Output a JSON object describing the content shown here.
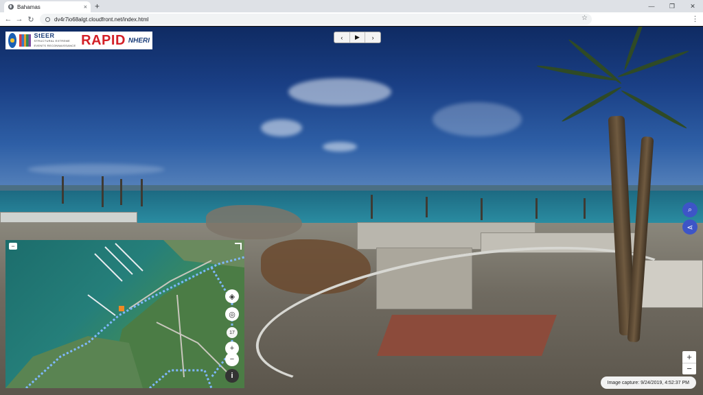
{
  "browser": {
    "tab_title": "Bahamas",
    "tab_close": "×",
    "new_tab": "+",
    "url": "dv4r7io68algt.cloudfront.net/index.html",
    "back": "←",
    "forward": "→",
    "reload": "↻",
    "bookmark": "☆",
    "menu": "⋮",
    "window_controls": {
      "minimize": "—",
      "maximize": "❐",
      "close": "✕"
    }
  },
  "logo": {
    "steer_title": "StEER",
    "steer_subtitle": "STRUCTURAL EXTREME EVENTS RECONNAISSANCE",
    "rapid": "RAPID",
    "nheri": "NHERI"
  },
  "playback": {
    "prev": "‹",
    "play": "▶",
    "next": "›"
  },
  "actions": {
    "search_icon": "⌕",
    "share_icon": "⋖"
  },
  "viewer_zoom": {
    "in": "+",
    "out": "−"
  },
  "capture_label": "Image capture: 9/24/2019, 4:52:37 PM",
  "minimap": {
    "collapse": "−",
    "layers_icon": "◈",
    "locate_icon": "◎",
    "zoom_level": "17",
    "zoom_in": "+",
    "zoom_out": "−",
    "info_icon": "i"
  },
  "colors": {
    "accent": "#3d55c7",
    "track": "#7fb8ff",
    "marker": "#f08a24"
  }
}
